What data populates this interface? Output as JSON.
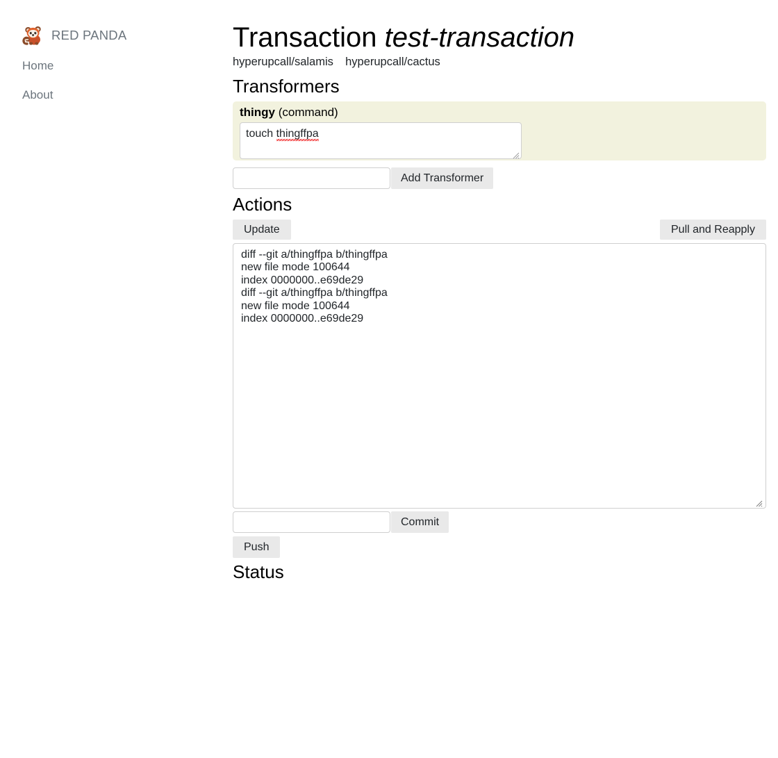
{
  "sidebar": {
    "brand": {
      "logo_icon": "red-panda-logo-icon",
      "label": "RED PANDA"
    },
    "items": [
      {
        "label": "Home"
      },
      {
        "label": "About"
      }
    ]
  },
  "main": {
    "title_prefix": "Transaction",
    "transaction_name": "test-transaction",
    "repos": [
      "hyperupcall/salamis",
      "hyperupcall/cactus"
    ],
    "transformers": {
      "heading": "Transformers",
      "cards": [
        {
          "name": "thingy",
          "type": "(command)",
          "command_value": "touch ",
          "command_misspelled": "thingffpa"
        }
      ],
      "add_input_value": "",
      "add_input_placeholder": "",
      "add_button_label": "Add Transformer"
    },
    "actions": {
      "heading": "Actions",
      "update_label": "Update",
      "pull_reapply_label": "Pull and Reapply",
      "diff_text": "diff --git a/thingffpa b/thingffpa\nnew file mode 100644\nindex 0000000..e69de29\ndiff --git a/thingffpa b/thingffpa\nnew file mode 100644\nindex 0000000..e69de29",
      "commit_input_value": "",
      "commit_input_placeholder": "",
      "commit_button_label": "Commit",
      "push_button_label": "Push"
    },
    "status": {
      "heading": "Status"
    }
  },
  "colors": {
    "card_background": "#f2f2de",
    "button_background": "#e9e9e9",
    "muted_text": "#6c757d",
    "spellcheck_underline": "#ee0000"
  }
}
